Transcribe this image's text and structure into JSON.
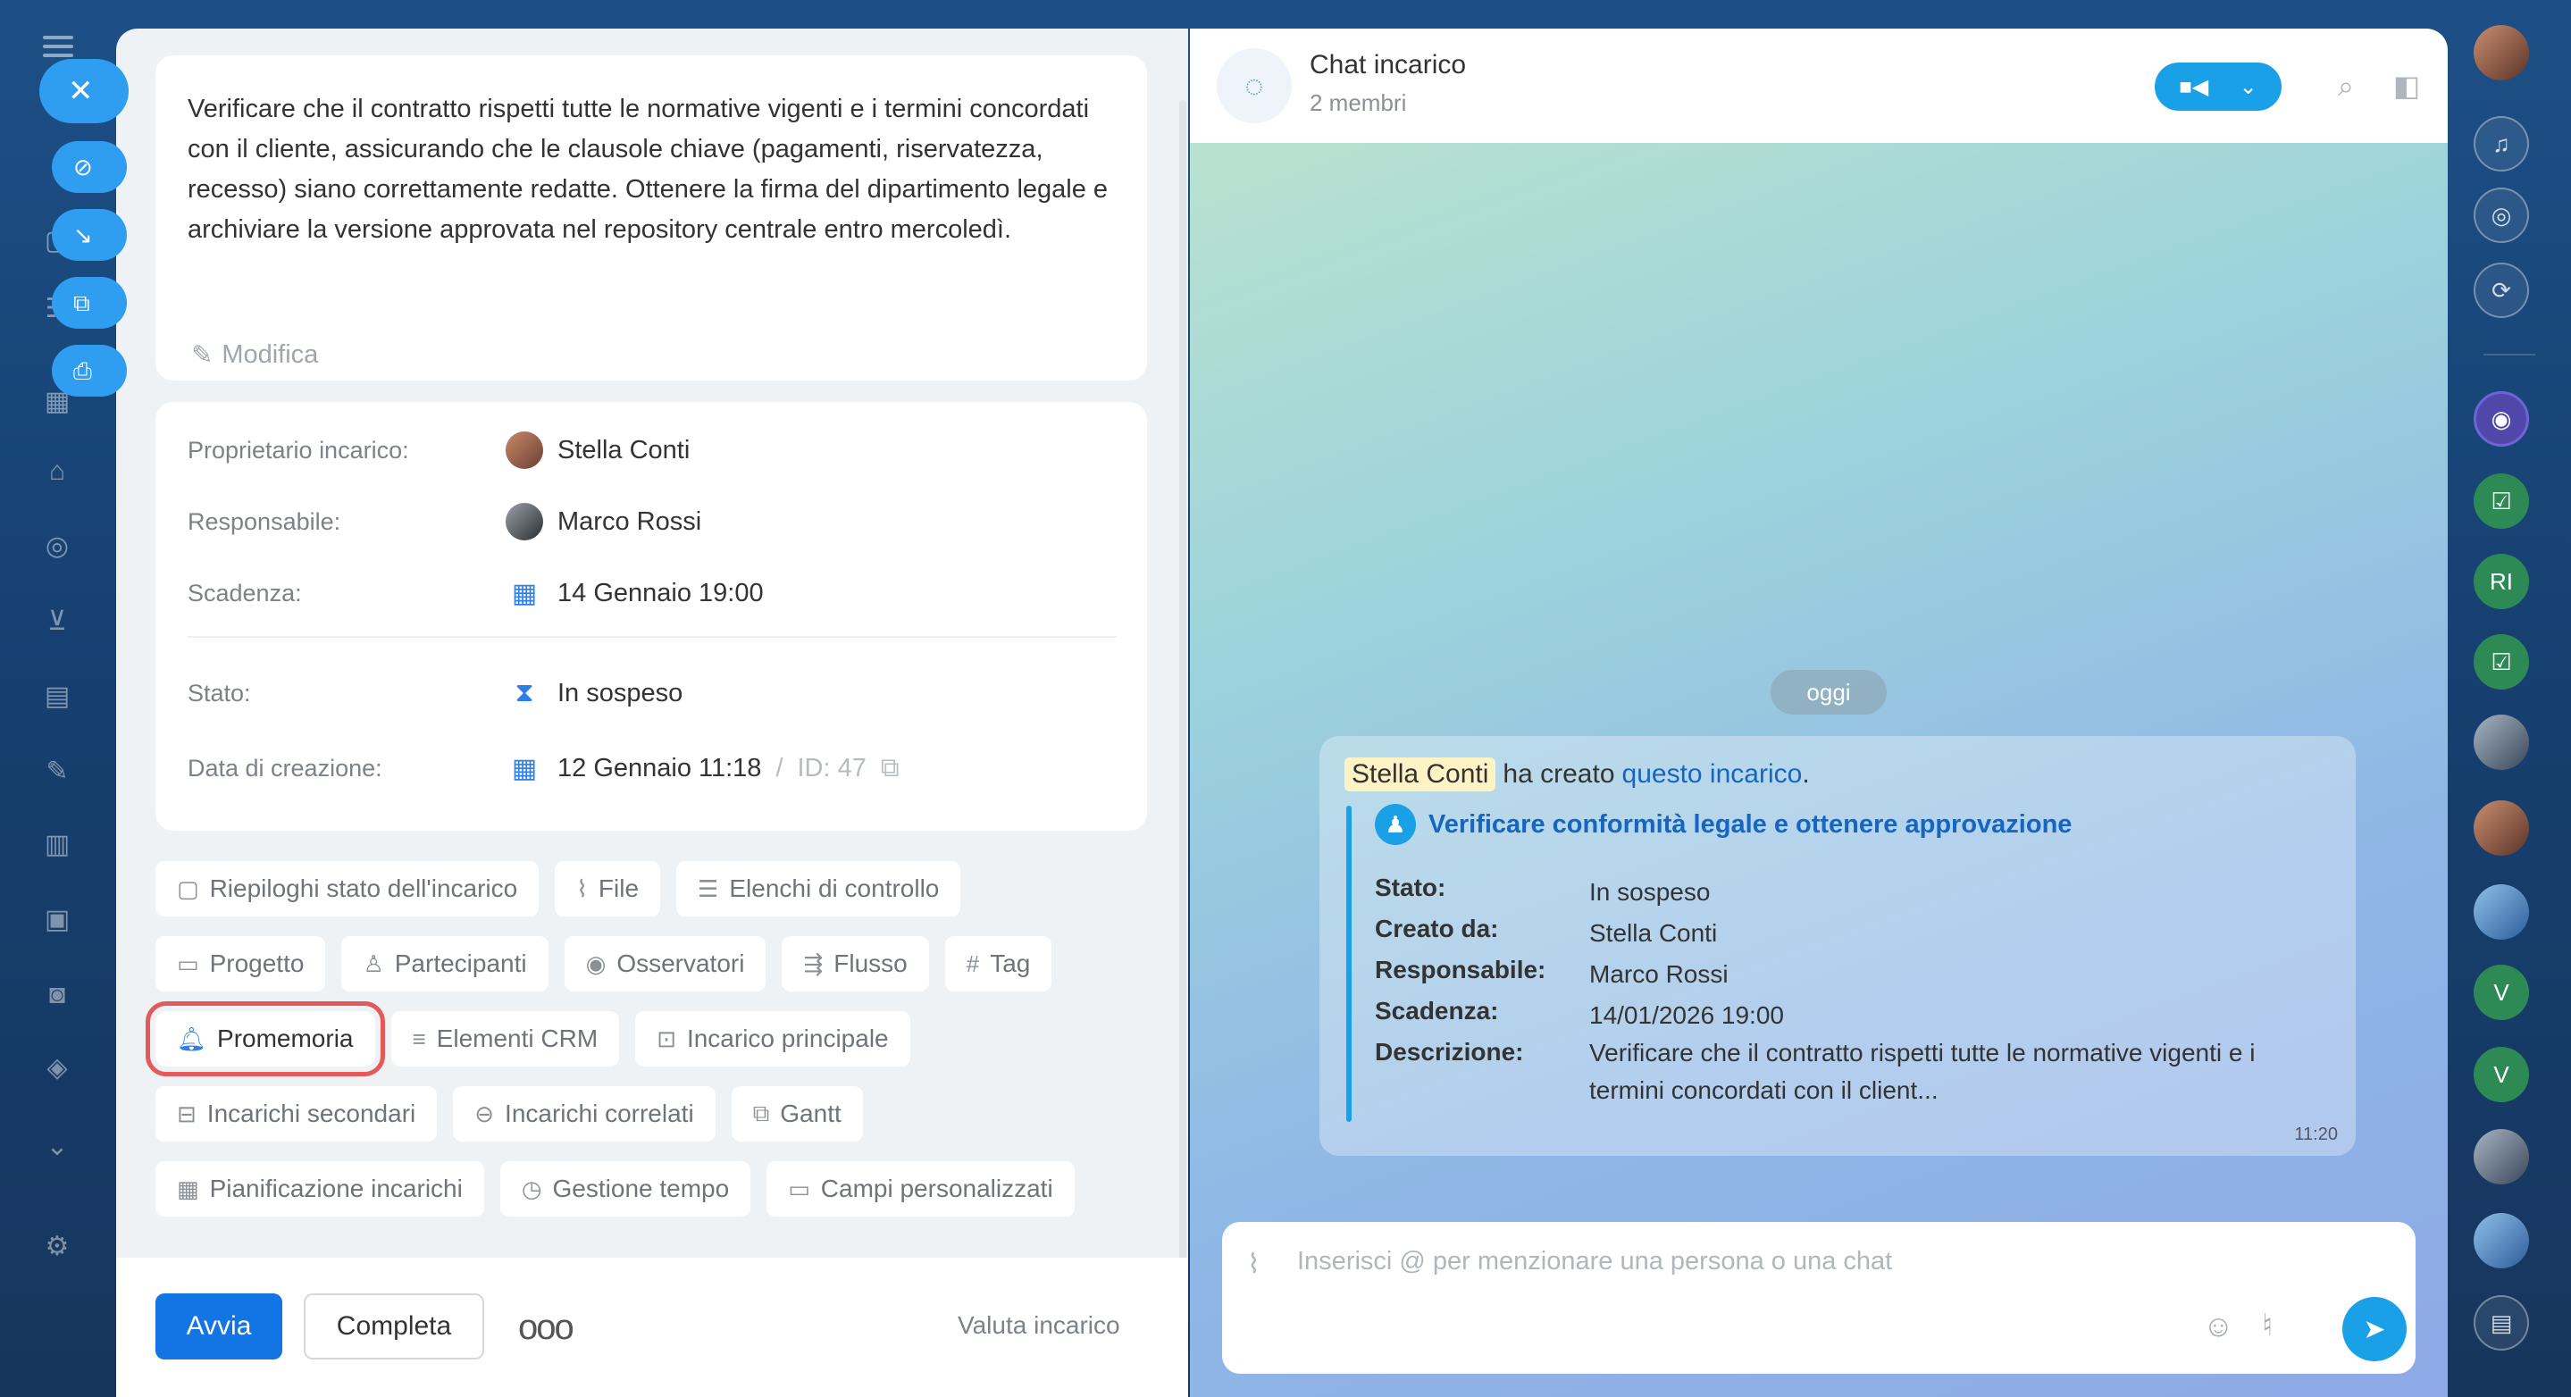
{
  "task": {
    "description": "Verificare che il contratto rispetti tutte le normative vigenti e i termini concordati con il cliente, assicurando che le clausole chiave (pagamenti, riservatezza, recesso) siano correttamente redatte. Ottenere la firma del dipartimento legale e archiviare la versione approvata nel repository centrale entro mercoledì.",
    "edit_label": "Modifica",
    "fields": {
      "owner_label": "Proprietario incarico:",
      "owner_value": "Stella Conti",
      "assignee_label": "Responsabile:",
      "assignee_value": "Marco Rossi",
      "deadline_label": "Scadenza:",
      "deadline_value": "14 Gennaio 19:00",
      "status_label": "Stato:",
      "status_value": "In sospeso",
      "created_label": "Data di creazione:",
      "created_value": "12 Gennaio 11:18",
      "id_sep": "/",
      "id_value": "ID: 47"
    },
    "chips": {
      "row1": [
        "Riepiloghi stato dell'incarico",
        "File",
        "Elenchi di controllo"
      ],
      "row2": [
        "Progetto",
        "Partecipanti",
        "Osservatori",
        "Flusso",
        "Tag"
      ],
      "row3": [
        "Promemoria",
        "Elementi CRM",
        "Incarico principale"
      ],
      "row4": [
        "Incarichi secondari",
        "Incarichi correlati",
        "Gantt"
      ],
      "row5": [
        "Pianificazione incarichi",
        "Gestione tempo",
        "Campi personalizzati"
      ]
    },
    "footer": {
      "start": "Avvia",
      "complete": "Completa",
      "more": "ooo",
      "rate": "Valuta incarico"
    }
  },
  "chat": {
    "title": "Chat incarico",
    "subtitle": "2 membri",
    "date_pill": "oggi",
    "message": {
      "author": "Stella Conti",
      "action": "ha creato",
      "link": "questo incarico",
      "dot": ".",
      "task_title": "Verificare conformità legale e ottenere approvazione",
      "rows": [
        {
          "k": "Stato:",
          "v": "In sospeso"
        },
        {
          "k": "Creato da:",
          "v": "Stella Conti"
        },
        {
          "k": "Responsabile:",
          "v": "Marco Rossi"
        },
        {
          "k": "Scadenza:",
          "v": "14/01/2026 19:00"
        },
        {
          "k": "Descrizione:",
          "v": "Verificare che il contratto rispetti tutte le normative vigenti e i termini concordati con il client..."
        }
      ],
      "time": "11:20"
    },
    "input_placeholder": "Inserisci @ per menzionare una persona o una chat"
  },
  "right_bar": {
    "initials_ri": "RI",
    "initials_v1": "V",
    "initials_v2": "V"
  },
  "colors": {
    "accent": "#1275e3",
    "chat_accent": "#1aa0e6",
    "highlight": "#e45a5a"
  }
}
